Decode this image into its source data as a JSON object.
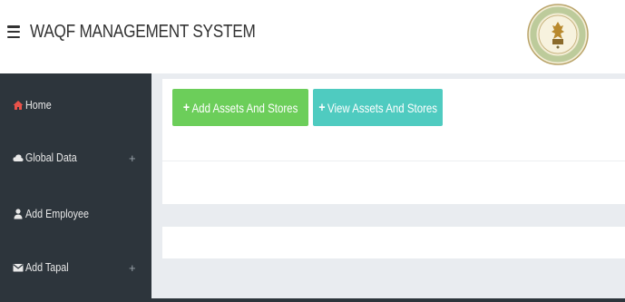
{
  "header": {
    "title": "WAQF MANAGEMENT SYSTEM",
    "menu_icon": "hamburger-icon",
    "logo_icon": "emblem-seal-icon"
  },
  "sidebar": {
    "items": [
      {
        "label": "Home",
        "icon": "home-icon",
        "has_expand": false,
        "expand": ""
      },
      {
        "label": "Global Data",
        "icon": "cloud-icon",
        "has_expand": true,
        "expand": "+"
      },
      {
        "label": "Add Employee",
        "icon": "user-icon",
        "has_expand": false,
        "expand": ""
      },
      {
        "label": "Add Tapal",
        "icon": "envelope-icon",
        "has_expand": true,
        "expand": "+"
      }
    ]
  },
  "main": {
    "buttons": {
      "add_assets": {
        "label": "Add Assets And Stores",
        "plus": "+",
        "color": "#6cce5a"
      },
      "view_assets": {
        "label": "View Assets And Stores",
        "plus": "+",
        "color": "#4fcbc0"
      }
    }
  },
  "colors": {
    "sidebar_bg": "#2d353c",
    "home_icon": "#e8524a",
    "content_bg": "#e9ecf0"
  }
}
